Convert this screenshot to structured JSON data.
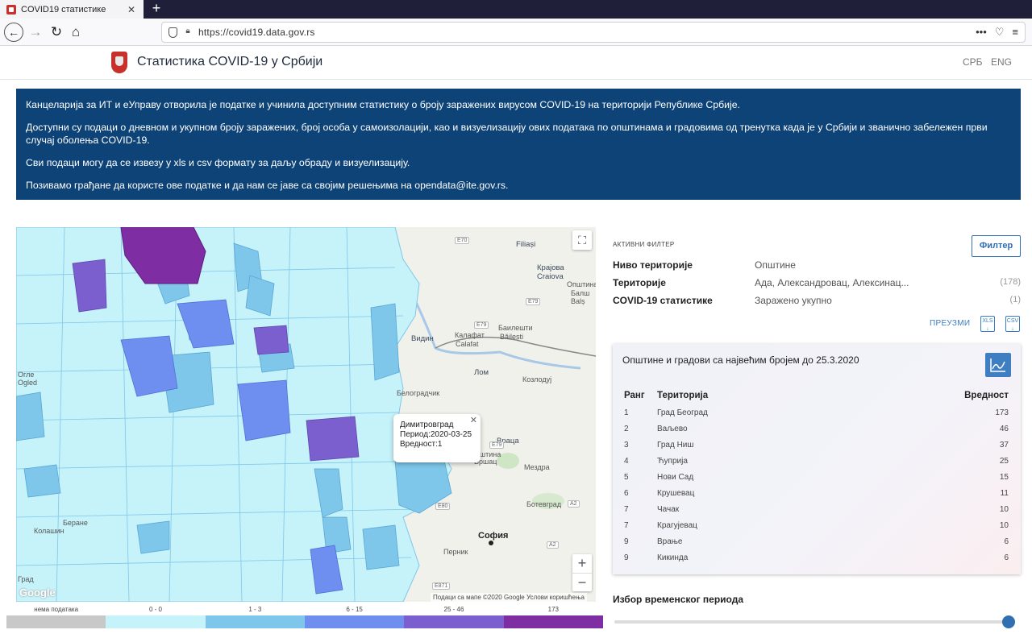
{
  "browser": {
    "tab_title": "COVID19 статистике",
    "tab_close": "✕",
    "new_tab": "+",
    "url": "https://covid19.data.gov.rs",
    "tools": [
      "•••",
      "♡",
      "≡"
    ]
  },
  "header": {
    "title": "Статистика COVID-19 у Србији",
    "lang_srb": "СРБ",
    "lang_eng": "ENG"
  },
  "banner": {
    "p1": "Канцеларија за ИТ и еУправу отворила је податке и учинила доступним статистику о броју заражених вирусом COVID-19 на територији Републике Србије.",
    "p2": "Доступни су подаци о дневном и укупном броју заражених, број особа у самоизолацији, као и визуелизацију ових података по општинама и градовима од тренутка када је у Србији и званично забележен први случај оболења COVID-19.",
    "p3": "Сви подаци могу да се извезу у xls и csv формату за даљу обраду и визуелизацију.",
    "p4": "Позивамо грађане да користе ове податке и да нам се јаве са својим решењима на opendata@ite.gov.rs."
  },
  "map": {
    "labels": {
      "filiasi": "Filiași",
      "krajova": "Крајова",
      "craiova": "Craiova",
      "opshtina": "Општина",
      "balsh": "Балш",
      "bals": "Balș",
      "bailesti_cyr": "Баилешти",
      "bailesti": "Băilești",
      "vidin": "Видин",
      "kalafat": "Калафат",
      "calafat": "Calafat",
      "lom": "Лом",
      "kozloduy": "Козлодуј",
      "belogradchik": "Белоградчик",
      "vratsa": "Враца",
      "mezdra": "Мездра",
      "botevgrad": "Ботевград",
      "sofia": "София",
      "pernik": "Перник",
      "berane": "Беране",
      "kolashin": "Колашин",
      "grad": "Град",
      "ogled": "Огле",
      "ogled_en": "Ogled",
      "opstina_a": "Општина",
      "vrsac": "Вршац"
    },
    "roads": [
      "E70",
      "E79",
      "E79",
      "E79",
      "E80",
      "A2",
      "A2",
      "E871"
    ],
    "google": "Google",
    "attribution": "Подаци са мапе ©2020 Google   Услови коришћења",
    "fullscreen_icon": "fullscreen-icon",
    "zoom_in": "+",
    "zoom_out": "−",
    "tooltip": {
      "name": "Димитровград",
      "period": "Период:2020-03-25",
      "value": "Вредност:1",
      "close": "✕"
    }
  },
  "legend": {
    "labels": [
      "нема података",
      "0 - 0",
      "1 - 3",
      "6 - 15",
      "25 - 46",
      "173"
    ],
    "colors": [
      "#c8c8c8",
      "#c6f2f9",
      "#7ec7ea",
      "#6f8ff0",
      "#7b5fcf",
      "#7e2ea2"
    ]
  },
  "filters": {
    "title": "АКТИВНИ ФИЛТЕР",
    "button": "Филтер",
    "rows": [
      {
        "key": "Ниво територије",
        "value": "Општине",
        "count": ""
      },
      {
        "key": "Територије",
        "value": "Ада, Александровац, Алексинац...",
        "count": "(178)"
      },
      {
        "key": "COVID-19 статистике",
        "value": "Заражено укупно",
        "count": "(1)"
      }
    ],
    "download": "ПРЕУЗМИ",
    "xls": "XLS",
    "csv": "CSV"
  },
  "ranking": {
    "title": "Општине и градови са највећим бројем до 25.3.2020",
    "headers": {
      "rank": "Ранг",
      "territory": "Територија",
      "value": "Вредност"
    },
    "rows": [
      {
        "rank": "1",
        "territory": "Град Београд",
        "value": "173"
      },
      {
        "rank": "2",
        "territory": "Ваљево",
        "value": "46"
      },
      {
        "rank": "3",
        "territory": "Град Ниш",
        "value": "37"
      },
      {
        "rank": "4",
        "territory": "Ћуприја",
        "value": "25"
      },
      {
        "rank": "5",
        "territory": "Нови Сад",
        "value": "15"
      },
      {
        "rank": "6",
        "territory": "Крушевац",
        "value": "11"
      },
      {
        "rank": "7",
        "territory": "Чачак",
        "value": "10"
      },
      {
        "rank": "7",
        "territory": "Крагујевац",
        "value": "10"
      },
      {
        "rank": "9",
        "territory": "Врање",
        "value": "6"
      },
      {
        "rank": "9",
        "territory": "Кикинда",
        "value": "6"
      }
    ]
  },
  "period": {
    "title": "Избор временског периода",
    "selected_fraction": 1.0
  }
}
